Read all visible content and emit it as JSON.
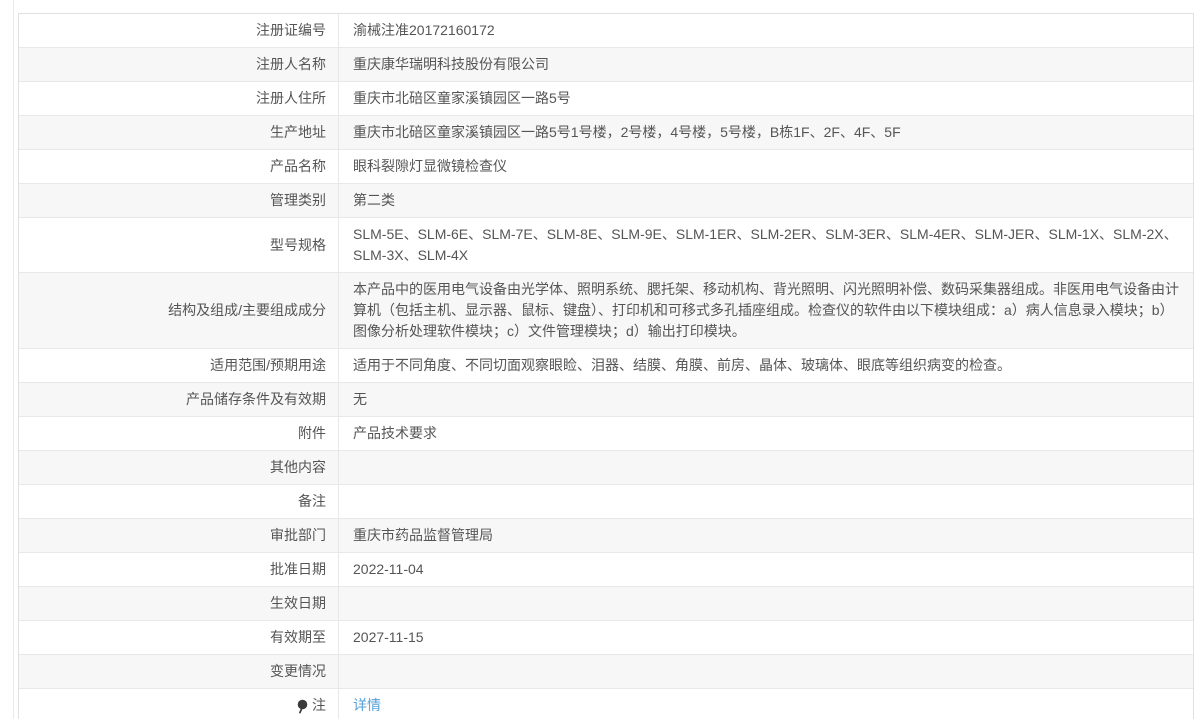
{
  "colors": {
    "row_stripe": "#f7f7f7",
    "row_white": "#ffffff",
    "border": "#e8e8e8",
    "outer_border": "#e0e0e0",
    "text": "#555555",
    "link_blue": "#54a0d8",
    "pin_icon": "#3a3a3a"
  },
  "icons": {
    "note_pin": "pin-icon"
  },
  "table": {
    "rows": [
      {
        "label": "注册证编号",
        "value": "渝械注准20172160172"
      },
      {
        "label": "注册人名称",
        "value": "重庆康华瑞明科技股份有限公司"
      },
      {
        "label": "注册人住所",
        "value": "重庆市北碚区童家溪镇园区一路5号"
      },
      {
        "label": "生产地址",
        "value": "重庆市北碚区童家溪镇园区一路5号1号楼，2号楼，4号楼，5号楼，B栋1F、2F、4F、5F"
      },
      {
        "label": "产品名称",
        "value": "眼科裂隙灯显微镜检查仪"
      },
      {
        "label": "管理类别",
        "value": "第二类"
      },
      {
        "label": "型号规格",
        "value": "SLM-5E、SLM-6E、SLM-7E、SLM-8E、SLM-9E、SLM-1ER、SLM-2ER、SLM-3ER、SLM-4ER、SLM-JER、SLM-1X、SLM-2X、SLM-3X、SLM-4X"
      },
      {
        "label": "结构及组成/主要组成成分",
        "value": "本产品中的医用电气设备由光学体、照明系统、腮托架、移动机构、背光照明、闪光照明补偿、数码采集器组成。非医用电气设备由计算机（包括主机、显示器、鼠标、键盘）、打印机和可移式多孔插座组成。检查仪的软件由以下模块组成：a）病人信息录入模块；b）图像分析处理软件模块；c）文件管理模块；d）输出打印模块。"
      },
      {
        "label": "适用范围/预期用途",
        "value": "适用于不同角度、不同切面观察眼睑、泪器、结膜、角膜、前房、晶体、玻璃体、眼底等组织病变的检查。"
      },
      {
        "label": "产品储存条件及有效期",
        "value": "无"
      },
      {
        "label": "附件",
        "value": "产品技术要求"
      },
      {
        "label": "其他内容",
        "value": ""
      },
      {
        "label": "备注",
        "value": ""
      },
      {
        "label": "审批部门",
        "value": "重庆市药品监督管理局"
      },
      {
        "label": "批准日期",
        "value": "2022-11-04"
      },
      {
        "label": "生效日期",
        "value": ""
      },
      {
        "label": "有效期至",
        "value": "2027-11-15"
      },
      {
        "label": "变更情况",
        "value": ""
      },
      {
        "label": "注",
        "value": "详情"
      }
    ]
  }
}
